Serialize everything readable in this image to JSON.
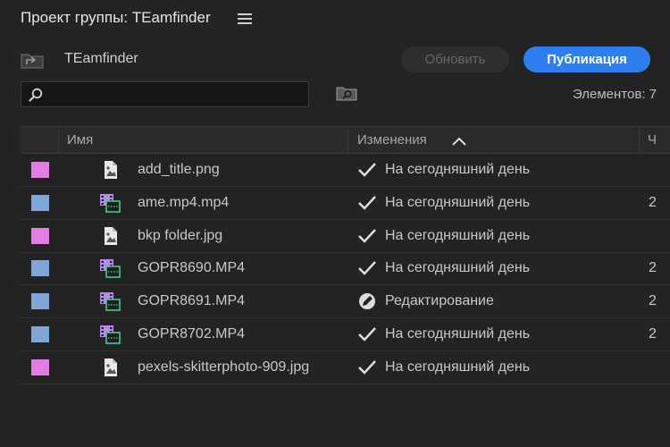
{
  "panel": {
    "title": "Проект группы: TEamfinder",
    "menu_icon": "hamburger-menu-icon"
  },
  "project": {
    "name": "TEamfinder",
    "icon": "folder-up-icon"
  },
  "buttons": {
    "refresh": "Обновить",
    "publish": "Публикация"
  },
  "search": {
    "value": "",
    "placeholder": "",
    "icon": "search-icon"
  },
  "bin_search_icon": "folder-search-icon",
  "item_count": "Элементов: 7",
  "table": {
    "columns": {
      "name": "Имя",
      "changes": "Изменения",
      "extra": "Ч"
    },
    "sort": "ascending",
    "rows": [
      {
        "swatch": "#e47de3",
        "type": "image",
        "name": "add_title.png",
        "status": "На сегодняшний день",
        "status_icon": "checkmark-icon",
        "extra": ""
      },
      {
        "swatch": "#7fa6d9",
        "type": "video",
        "name": "ame.mp4.mp4",
        "status": "На сегодняшний день",
        "status_icon": "checkmark-icon",
        "extra": "2"
      },
      {
        "swatch": "#e47de3",
        "type": "image",
        "name": "bkp folder.jpg",
        "status": "На сегодняшний день",
        "status_icon": "checkmark-icon",
        "extra": ""
      },
      {
        "swatch": "#7fa6d9",
        "type": "video",
        "name": "GOPR8690.MP4",
        "status": "На сегодняшний день",
        "status_icon": "checkmark-icon",
        "extra": "2"
      },
      {
        "swatch": "#7fa6d9",
        "type": "video",
        "name": "GOPR8691.MP4",
        "status": "Редактирование",
        "status_icon": "pencil-edit-icon",
        "extra": "2"
      },
      {
        "swatch": "#7fa6d9",
        "type": "video",
        "name": "GOPR8702.MP4",
        "status": "На сегодняшний день",
        "status_icon": "checkmark-icon",
        "extra": "2"
      },
      {
        "swatch": "#e47de3",
        "type": "image",
        "name": "pexels-skitterphoto-909.jpg",
        "status": "На сегодняшний день",
        "status_icon": "checkmark-icon",
        "extra": ""
      }
    ]
  }
}
